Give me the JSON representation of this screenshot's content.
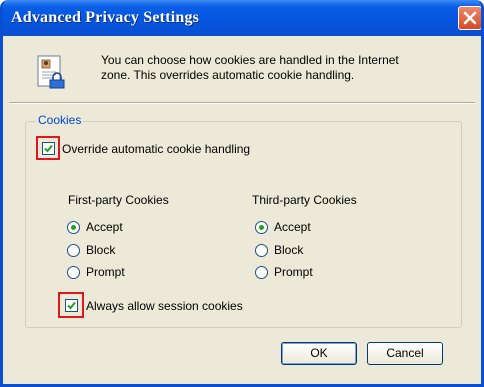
{
  "window": {
    "title": "Advanced Privacy Settings",
    "close_icon": "close-icon",
    "title_bar_color": "#0a4fd1"
  },
  "info": {
    "icon": "privacy-document-icon",
    "line1": "You can choose how cookies are handled in the Internet",
    "line2": "zone.  This overrides automatic cookie handling."
  },
  "cookies": {
    "group_label": "Cookies",
    "override": {
      "label": "Override automatic cookie handling",
      "checked": true
    },
    "first_party": {
      "heading": "First-party Cookies",
      "options": [
        {
          "label": "Accept",
          "selected": true
        },
        {
          "label": "Block",
          "selected": false
        },
        {
          "label": "Prompt",
          "selected": false
        }
      ]
    },
    "third_party": {
      "heading": "Third-party Cookies",
      "options": [
        {
          "label": "Accept",
          "selected": true
        },
        {
          "label": "Block",
          "selected": false
        },
        {
          "label": "Prompt",
          "selected": false
        }
      ]
    },
    "session": {
      "label": "Always allow session cookies",
      "checked": true
    }
  },
  "buttons": {
    "ok": "OK",
    "cancel": "Cancel"
  },
  "highlight_color": "#e0181c"
}
